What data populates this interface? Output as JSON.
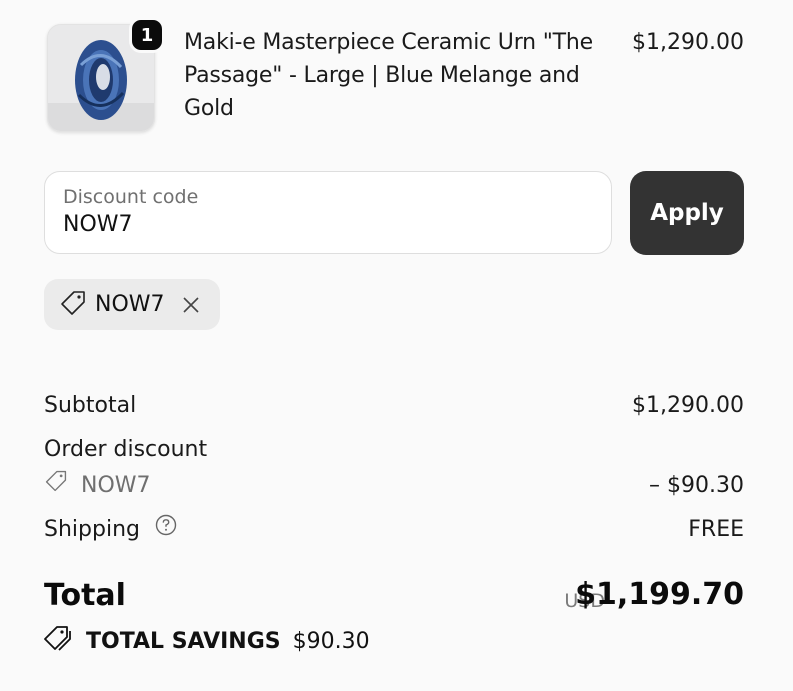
{
  "line_item": {
    "quantity": "1",
    "title": "Maki-e Masterpiece Ceramic Urn \"The Passage\" - Large | Blue Melange and Gold",
    "price": "$1,290.00",
    "thumbnail_icon": "ceramic-urn-thumbnail"
  },
  "discount": {
    "label": "Discount code",
    "value": "NOW7",
    "apply_label": "Apply",
    "applied_code": "NOW7"
  },
  "summary": {
    "subtotal_label": "Subtotal",
    "subtotal_value": "$1,290.00",
    "order_discount_label": "Order discount",
    "discount_code": "NOW7",
    "discount_value": "– $90.30",
    "shipping_label": "Shipping",
    "shipping_value": "FREE"
  },
  "total": {
    "label": "Total",
    "currency": "USD",
    "amount": "$1,199.70",
    "savings_label": "TOTAL SAVINGS",
    "savings_value": "$90.30"
  },
  "colors": {
    "background": "#fafafa",
    "apply_button": "#333333",
    "chip_background": "#ebebeb",
    "muted_text": "#6f6f6f"
  }
}
